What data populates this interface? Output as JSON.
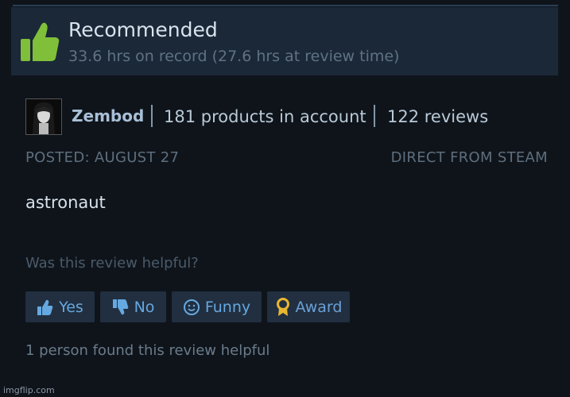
{
  "recommendation": {
    "title": "Recommended",
    "hours": "33.6 hrs on record (27.6 hrs at review time)",
    "icon": "thumbs-up-icon",
    "icon_color": "#7fbf3a"
  },
  "author": {
    "name": "Zembod",
    "products": "181 products in account",
    "reviews": "122 reviews"
  },
  "meta": {
    "posted": "POSTED: AUGUST 27",
    "source": "DIRECT FROM STEAM"
  },
  "review": {
    "text": "astronaut"
  },
  "helpfulness": {
    "question": "Was this review helpful?",
    "yes_label": "Yes",
    "no_label": "No",
    "funny_label": "Funny",
    "award_label": "Award",
    "count_text": "1 person found this review helpful"
  },
  "watermark": "imgflip.com",
  "colors": {
    "background": "#0f141b",
    "panel": "#1b2838",
    "button": "#212f40",
    "button_text": "#66a8e0",
    "award_icon": "#e8b730"
  }
}
